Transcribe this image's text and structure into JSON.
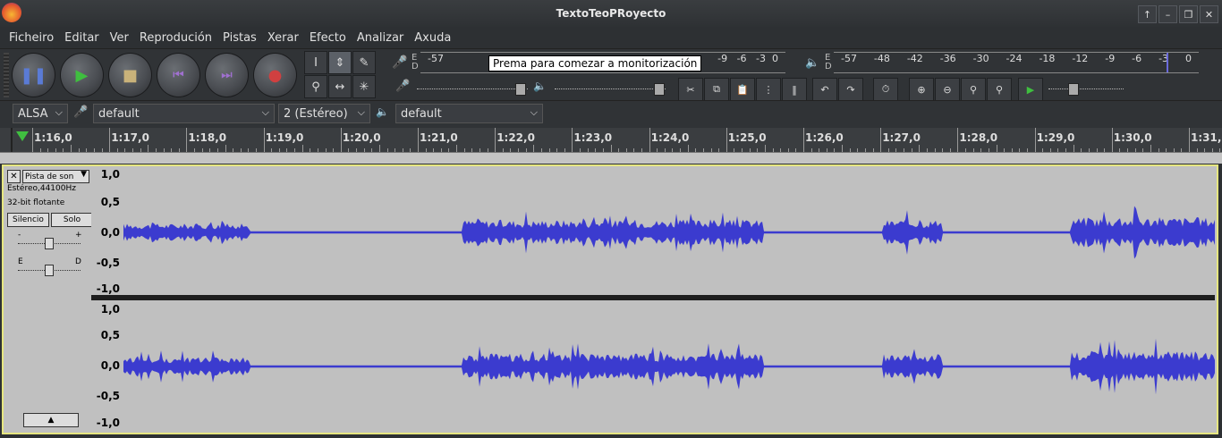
{
  "window": {
    "title": "TextoTeoPRoyecto",
    "controls": [
      "↑",
      "–",
      "❐",
      "✕"
    ]
  },
  "menu": [
    "Ficheiro",
    "Editar",
    "Ver",
    "Reprodución",
    "Pistas",
    "Xerar",
    "Efecto",
    "Analizar",
    "Axuda"
  ],
  "tooltip": "Prema para comezar a monitorización",
  "recording_meter": {
    "lr": "E\nD",
    "ticks_left": "-57",
    "ticks_right": "-9   -6   -3  0"
  },
  "playback_meter": {
    "lr": "E\nD",
    "ticks": [
      "-57",
      "-48",
      "-42",
      "-36",
      "-30",
      "-24",
      "-18",
      "-12",
      "-9",
      "-6",
      "-3",
      "0"
    ]
  },
  "devices": {
    "host": "ALSA",
    "recording_device": "default",
    "channels": "2 (Estéreo)",
    "playback_device": "default"
  },
  "timeline": {
    "ticks": [
      "1:16,0",
      "1:17,0",
      "1:18,0",
      "1:19,0",
      "1:20,0",
      "1:21,0",
      "1:22,0",
      "1:23,0",
      "1:24,0",
      "1:25,0",
      "1:26,0",
      "1:27,0",
      "1:28,0",
      "1:29,0",
      "1:30,0",
      "1:31,0"
    ]
  },
  "track": {
    "name": "Pista de son",
    "close": "✕",
    "info1": "Estéreo,44100Hz",
    "info2": "32-bit flotante",
    "mute": "Silencio",
    "solo": "Solo",
    "gain_minus": "-",
    "gain_plus": "+",
    "pan_left": "E",
    "pan_right": "D",
    "collapse": "▲",
    "scale": [
      "1,0",
      "0,5",
      "0,0",
      "-0,5",
      "-1,0"
    ]
  },
  "colors": {
    "waveform": "#3b3bcf",
    "waveform_light": "#6464e6",
    "selection_border": "#e6e680"
  }
}
